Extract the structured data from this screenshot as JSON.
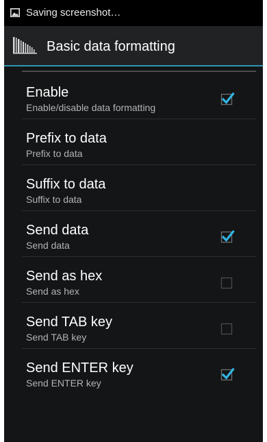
{
  "status_bar": {
    "notification_icon": "image-icon",
    "text": "Saving screenshot…"
  },
  "action_bar": {
    "app_icon": "barcode-icon",
    "title": "Basic data formatting"
  },
  "colors": {
    "accent": "#33b5e5",
    "background": "#131516",
    "action_bar": "#202224",
    "divider_accent": "#2f96b4"
  },
  "preferences": [
    {
      "title": "Enable",
      "summary": "Enable/disable data formatting",
      "has_checkbox": true,
      "checked": true
    },
    {
      "title": "Prefix to data",
      "summary": "Prefix to data",
      "has_checkbox": false,
      "checked": false
    },
    {
      "title": "Suffix to data",
      "summary": "Suffix to data",
      "has_checkbox": false,
      "checked": false
    },
    {
      "title": "Send data",
      "summary": "Send data",
      "has_checkbox": true,
      "checked": true
    },
    {
      "title": "Send as hex",
      "summary": "Send as hex",
      "has_checkbox": true,
      "checked": false
    },
    {
      "title": "Send TAB key",
      "summary": "Send TAB key",
      "has_checkbox": true,
      "checked": false
    },
    {
      "title": "Send ENTER key",
      "summary": "Send ENTER key",
      "has_checkbox": true,
      "checked": true
    }
  ]
}
